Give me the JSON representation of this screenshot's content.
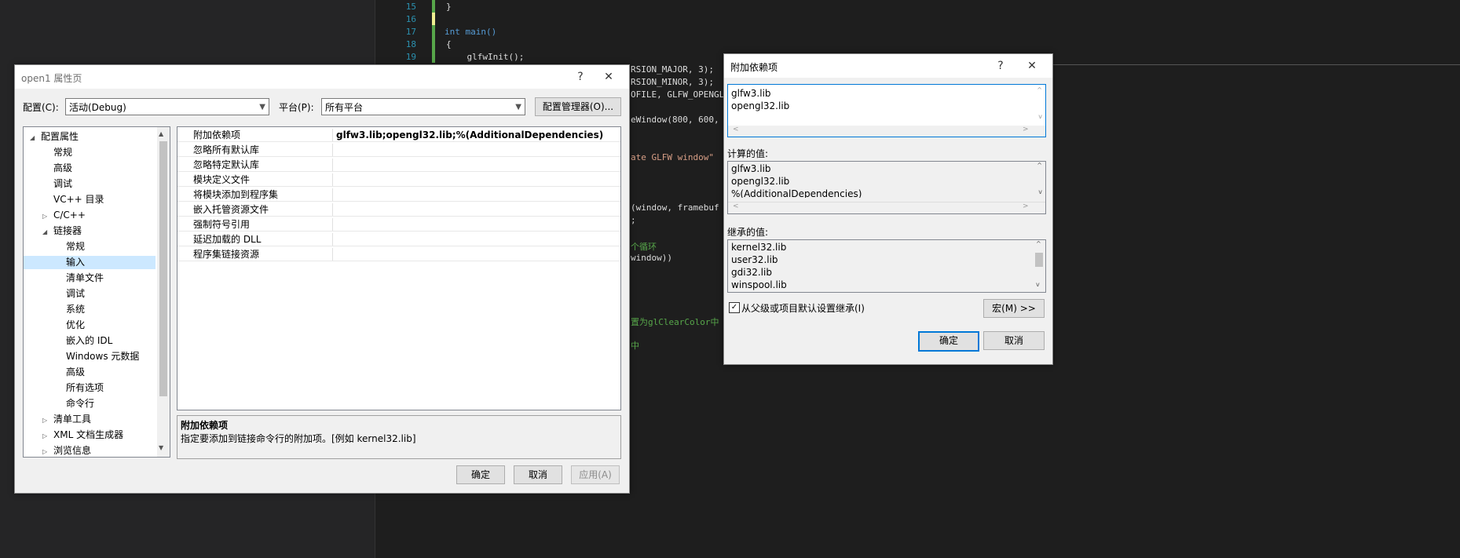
{
  "editor": {
    "lines": [
      {
        "num": "15",
        "code": "}"
      },
      {
        "num": "16",
        "code": ""
      },
      {
        "num": "17",
        "code": "int main()"
      },
      {
        "num": "18",
        "code": "{"
      },
      {
        "num": "19",
        "code": "    glfwInit();"
      }
    ],
    "fragments": [
      "RSION_MAJOR, 3);",
      "RSION_MINOR, 3);",
      "OFILE, GLFW_OPENGL",
      "eWindow(800, 600,",
      "ate GLFW window\"",
      "(window, framebuf",
      ";",
      "个循环",
      "window))",
      "置为glClearColor中",
      "中"
    ]
  },
  "props": {
    "title": "open1 属性页",
    "help": "?",
    "close": "✕",
    "config_label": "配置(C):",
    "config_value": "活动(Debug)",
    "platform_label": "平台(P):",
    "platform_value": "所有平台",
    "config_manager": "配置管理器(O)...",
    "tree": [
      {
        "label": "配置属性",
        "level": 0,
        "exp": "◢"
      },
      {
        "label": "常规",
        "level": 1
      },
      {
        "label": "高级",
        "level": 1
      },
      {
        "label": "调试",
        "level": 1
      },
      {
        "label": "VC++ 目录",
        "level": 1
      },
      {
        "label": "C/C++",
        "level": 1,
        "exp": "▷"
      },
      {
        "label": "链接器",
        "level": 1,
        "exp": "◢"
      },
      {
        "label": "常规",
        "level": 2
      },
      {
        "label": "输入",
        "level": 2,
        "sel": true
      },
      {
        "label": "清单文件",
        "level": 2
      },
      {
        "label": "调试",
        "level": 2
      },
      {
        "label": "系统",
        "level": 2
      },
      {
        "label": "优化",
        "level": 2
      },
      {
        "label": "嵌入的 IDL",
        "level": 2
      },
      {
        "label": "Windows 元数据",
        "level": 2
      },
      {
        "label": "高级",
        "level": 2
      },
      {
        "label": "所有选项",
        "level": 2
      },
      {
        "label": "命令行",
        "level": 2
      },
      {
        "label": "清单工具",
        "level": 1,
        "exp": "▷"
      },
      {
        "label": "XML 文档生成器",
        "level": 1,
        "exp": "▷"
      },
      {
        "label": "浏览信息",
        "level": 1,
        "exp": "▷"
      }
    ],
    "grid": [
      {
        "name": "附加依赖项",
        "value": "glfw3.lib;opengl32.lib;%(AdditionalDependencies)"
      },
      {
        "name": "忽略所有默认库",
        "value": ""
      },
      {
        "name": "忽略特定默认库",
        "value": ""
      },
      {
        "name": "模块定义文件",
        "value": ""
      },
      {
        "name": "将模块添加到程序集",
        "value": ""
      },
      {
        "name": "嵌入托管资源文件",
        "value": ""
      },
      {
        "name": "强制符号引用",
        "value": ""
      },
      {
        "name": "延迟加载的 DLL",
        "value": ""
      },
      {
        "name": "程序集链接资源",
        "value": ""
      }
    ],
    "desc_title": "附加依赖项",
    "desc_text": "指定要添加到链接命令行的附加项。[例如 kernel32.lib]",
    "ok": "确定",
    "cancel": "取消",
    "apply": "应用(A)"
  },
  "dep": {
    "title": "附加依赖项",
    "help": "?",
    "close": "✕",
    "edit_lines": [
      "glfw3.lib",
      "opengl32.lib"
    ],
    "computed_label": "计算的值:",
    "computed": [
      "glfw3.lib",
      "opengl32.lib",
      "%(AdditionalDependencies)"
    ],
    "inherited_label": "继承的值:",
    "inherited": [
      "kernel32.lib",
      "user32.lib",
      "gdi32.lib",
      "winspool.lib"
    ],
    "inherit_check": "从父级或项目默认设置继承(I)",
    "inherit_checked": "✓",
    "macro": "宏(M) >>",
    "ok": "确定",
    "cancel": "取消"
  }
}
